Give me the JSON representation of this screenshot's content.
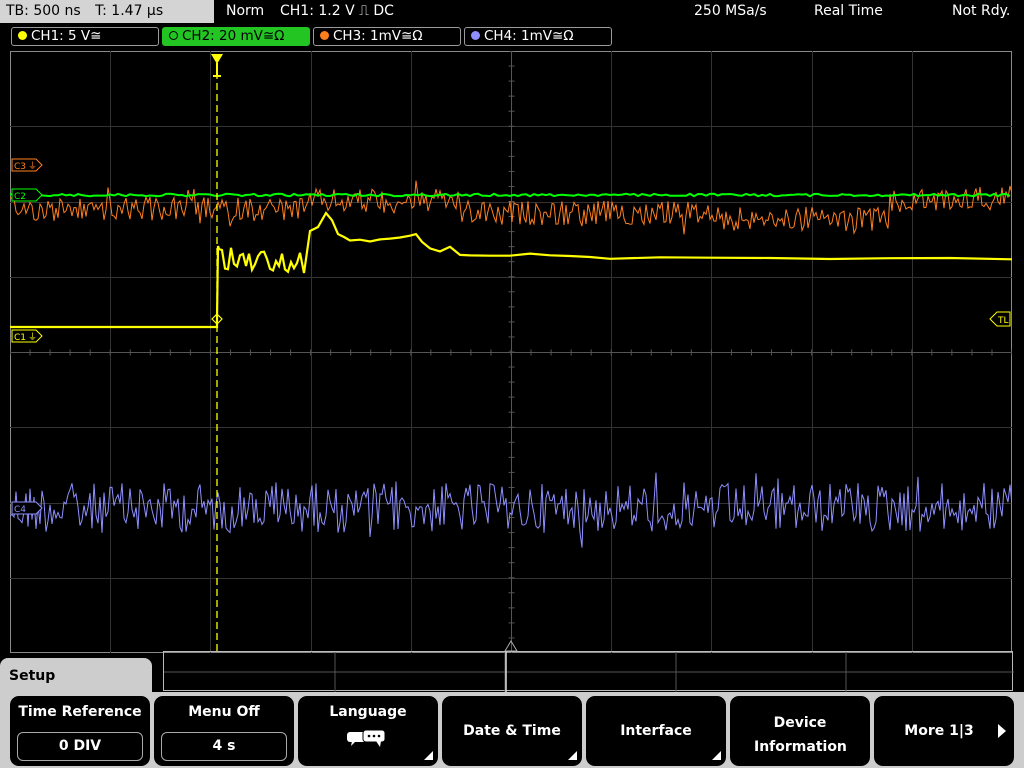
{
  "header": {
    "timebase": "TB: 500 ns",
    "trigger_time": "T: 1.47 µs",
    "mode": "Norm",
    "trigger": "CH1: 1.2 V ⎍ DC",
    "sample_rate": "250 MSa/s",
    "acq_mode": "Real Time",
    "status": "Not Rdy."
  },
  "channels": [
    {
      "label": "CH1: 5 V≅",
      "color": "#ffff00",
      "active": false
    },
    {
      "label": "CH2: 20 mV≅Ω",
      "color": "#00ff00",
      "active": true
    },
    {
      "label": "CH3: 1mV≅Ω",
      "color": "#ff7f1e",
      "active": false
    },
    {
      "label": "CH4: 1mV≅Ω",
      "color": "#8f8fff",
      "active": false
    }
  ],
  "markers": {
    "c3": "C3",
    "c2": "C2",
    "c1": "C1",
    "c4": "C4",
    "trigger_level": "TL"
  },
  "menu": {
    "title": "Setup",
    "time_reference": {
      "label": "Time Reference",
      "value": "0 DIV"
    },
    "menu_off": {
      "label": "Menu Off",
      "value": "4 s"
    },
    "language": {
      "label": "Language"
    },
    "date_time": {
      "label": "Date & Time"
    },
    "interface": {
      "label": "Interface"
    },
    "device_info": {
      "label": "Device Information"
    },
    "more": {
      "label": "More 1|3"
    }
  }
}
